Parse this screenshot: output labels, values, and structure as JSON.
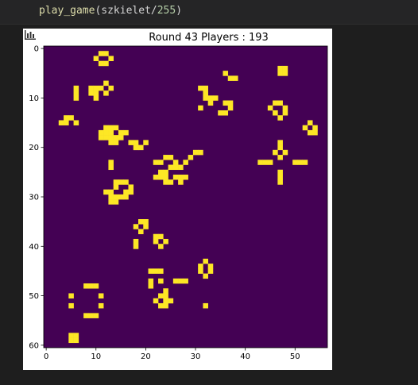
{
  "code": {
    "function": "play_game",
    "argument": "szkielet",
    "divisor": "255"
  },
  "plot": {
    "title": "Round 43  Players : 193",
    "background_color": "#440154",
    "cell_color": "#fde725",
    "x_ticks": [
      "0",
      "10",
      "20",
      "30",
      "40",
      "50"
    ],
    "y_ticks": [
      "0",
      "10",
      "20",
      "30",
      "40",
      "50",
      "60"
    ]
  },
  "chart_data": {
    "type": "heatmap",
    "title": "Round 43  Players : 193",
    "xlim": [
      -0.5,
      56.5
    ],
    "ylim": [
      -0.5,
      60.5
    ],
    "colormap": "viridis",
    "values": [
      0,
      1
    ],
    "live_cells": [
      [
        11,
        1
      ],
      [
        12,
        1
      ],
      [
        10,
        2
      ],
      [
        13,
        2
      ],
      [
        11,
        3
      ],
      [
        12,
        3
      ],
      [
        47,
        4
      ],
      [
        48,
        4
      ],
      [
        47,
        5
      ],
      [
        48,
        5
      ],
      [
        36,
        5
      ],
      [
        37,
        6
      ],
      [
        38,
        6
      ],
      [
        12,
        7
      ],
      [
        6,
        8
      ],
      [
        9,
        8
      ],
      [
        10,
        8
      ],
      [
        11,
        8
      ],
      [
        13,
        8
      ],
      [
        31,
        8
      ],
      [
        32,
        8
      ],
      [
        6,
        9
      ],
      [
        9,
        9
      ],
      [
        10,
        9
      ],
      [
        12,
        9
      ],
      [
        32,
        9
      ],
      [
        6,
        10
      ],
      [
        10,
        10
      ],
      [
        32,
        10
      ],
      [
        33,
        10
      ],
      [
        34,
        10
      ],
      [
        33,
        11
      ],
      [
        36,
        11
      ],
      [
        37,
        11
      ],
      [
        31,
        12
      ],
      [
        37,
        12
      ],
      [
        35,
        13
      ],
      [
        36,
        13
      ],
      [
        46,
        11
      ],
      [
        47,
        11
      ],
      [
        45,
        12
      ],
      [
        48,
        12
      ],
      [
        46,
        13
      ],
      [
        48,
        13
      ],
      [
        47,
        14
      ],
      [
        4,
        14
      ],
      [
        5,
        14
      ],
      [
        3,
        15
      ],
      [
        4,
        15
      ],
      [
        6,
        15
      ],
      [
        53,
        15
      ],
      [
        12,
        16
      ],
      [
        13,
        16
      ],
      [
        14,
        16
      ],
      [
        52,
        16
      ],
      [
        54,
        16
      ],
      [
        11,
        17
      ],
      [
        12,
        17
      ],
      [
        13,
        17
      ],
      [
        15,
        17
      ],
      [
        16,
        17
      ],
      [
        53,
        17
      ],
      [
        54,
        17
      ],
      [
        11,
        18
      ],
      [
        12,
        18
      ],
      [
        13,
        18
      ],
      [
        14,
        18
      ],
      [
        15,
        18
      ],
      [
        13,
        19
      ],
      [
        14,
        19
      ],
      [
        17,
        19
      ],
      [
        18,
        19
      ],
      [
        20,
        19
      ],
      [
        47,
        19
      ],
      [
        47,
        20
      ],
      [
        18,
        20
      ],
      [
        19,
        20
      ],
      [
        46,
        21
      ],
      [
        48,
        21
      ],
      [
        30,
        21
      ],
      [
        31,
        21
      ],
      [
        24,
        22
      ],
      [
        25,
        22
      ],
      [
        29,
        22
      ],
      [
        47,
        22
      ],
      [
        22,
        23
      ],
      [
        23,
        23
      ],
      [
        26,
        23
      ],
      [
        28,
        23
      ],
      [
        43,
        23
      ],
      [
        44,
        23
      ],
      [
        45,
        23
      ],
      [
        50,
        23
      ],
      [
        51,
        23
      ],
      [
        52,
        23
      ],
      [
        13,
        23
      ],
      [
        25,
        24
      ],
      [
        26,
        24
      ],
      [
        27,
        24
      ],
      [
        13,
        24
      ],
      [
        23,
        25
      ],
      [
        24,
        25
      ],
      [
        47,
        25
      ],
      [
        22,
        26
      ],
      [
        23,
        26
      ],
      [
        24,
        26
      ],
      [
        26,
        26
      ],
      [
        27,
        26
      ],
      [
        28,
        26
      ],
      [
        47,
        26
      ],
      [
        24,
        27
      ],
      [
        25,
        27
      ],
      [
        27,
        27
      ],
      [
        47,
        27
      ],
      [
        14,
        27
      ],
      [
        15,
        27
      ],
      [
        16,
        27
      ],
      [
        14,
        28
      ],
      [
        17,
        28
      ],
      [
        12,
        29
      ],
      [
        13,
        29
      ],
      [
        16,
        29
      ],
      [
        17,
        29
      ],
      [
        13,
        30
      ],
      [
        14,
        30
      ],
      [
        15,
        30
      ],
      [
        16,
        30
      ],
      [
        13,
        31
      ],
      [
        14,
        31
      ],
      [
        19,
        35
      ],
      [
        20,
        35
      ],
      [
        18,
        36
      ],
      [
        20,
        36
      ],
      [
        19,
        37
      ],
      [
        22,
        38
      ],
      [
        23,
        38
      ],
      [
        18,
        39
      ],
      [
        22,
        39
      ],
      [
        24,
        39
      ],
      [
        18,
        40
      ],
      [
        23,
        40
      ],
      [
        32,
        43
      ],
      [
        31,
        44
      ],
      [
        33,
        44
      ],
      [
        31,
        45
      ],
      [
        33,
        45
      ],
      [
        32,
        46
      ],
      [
        21,
        45
      ],
      [
        22,
        45
      ],
      [
        23,
        45
      ],
      [
        21,
        47
      ],
      [
        21,
        48
      ],
      [
        23,
        47
      ],
      [
        26,
        47
      ],
      [
        27,
        47
      ],
      [
        28,
        47
      ],
      [
        8,
        48
      ],
      [
        9,
        48
      ],
      [
        10,
        48
      ],
      [
        24,
        49
      ],
      [
        23,
        50
      ],
      [
        24,
        50
      ],
      [
        5,
        50
      ],
      [
        11,
        50
      ],
      [
        22,
        51
      ],
      [
        24,
        51
      ],
      [
        25,
        51
      ],
      [
        5,
        52
      ],
      [
        11,
        52
      ],
      [
        32,
        52
      ],
      [
        23,
        52
      ],
      [
        24,
        52
      ],
      [
        8,
        54
      ],
      [
        9,
        54
      ],
      [
        10,
        54
      ],
      [
        5,
        58
      ],
      [
        6,
        58
      ],
      [
        5,
        59
      ],
      [
        6,
        59
      ]
    ]
  }
}
